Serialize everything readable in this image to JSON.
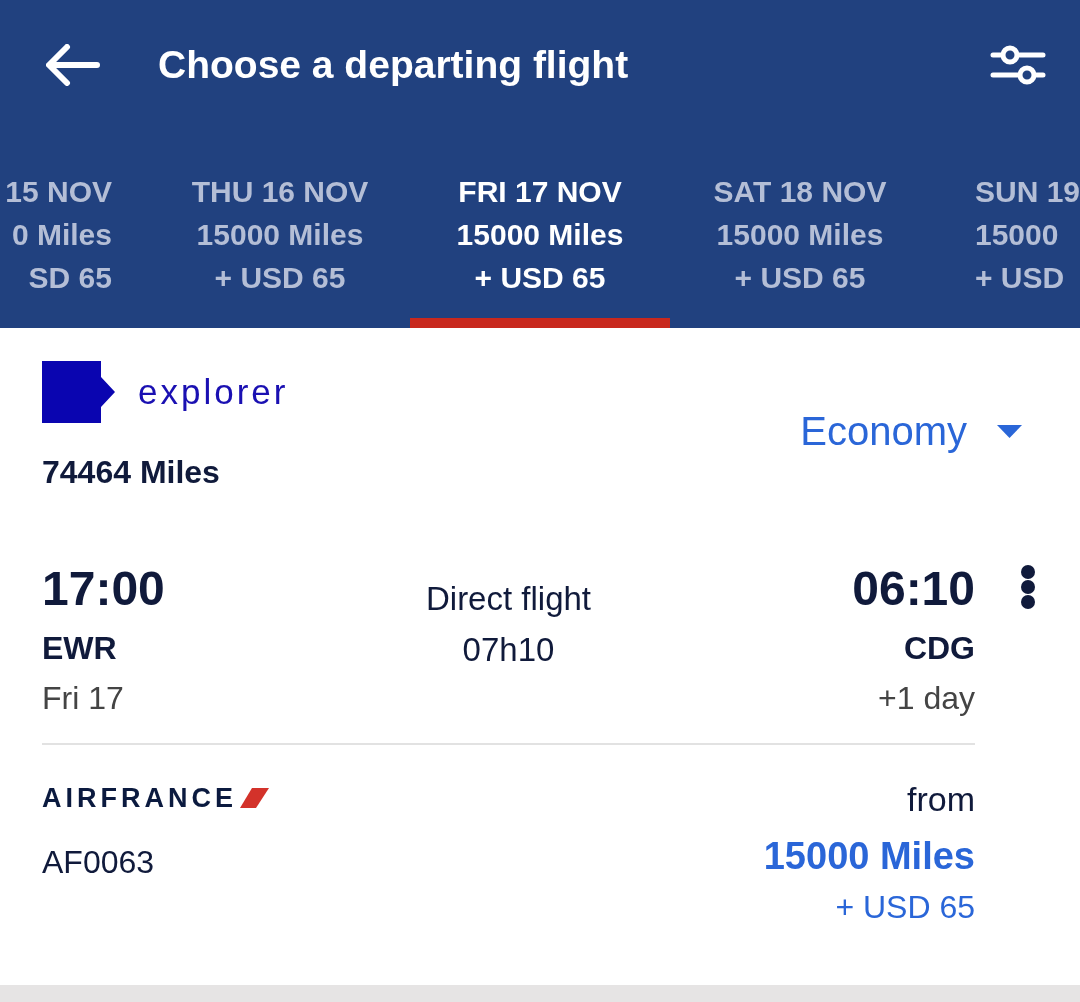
{
  "header": {
    "title": "Choose a departing flight"
  },
  "date_tabs": [
    {
      "date": "15 NOV",
      "price": "0 Miles",
      "fee": "SD 65",
      "selected": false
    },
    {
      "date": "THU 16 NOV",
      "price": "15000 Miles",
      "fee": "+ USD 65",
      "selected": false
    },
    {
      "date": "FRI 17 NOV",
      "price": "15000 Miles",
      "fee": "+ USD 65",
      "selected": true
    },
    {
      "date": "SAT 18 NOV",
      "price": "15000 Miles",
      "fee": "+ USD 65",
      "selected": false
    },
    {
      "date": "SUN 19",
      "price": "15000",
      "fee": "+ USD",
      "selected": false
    }
  ],
  "account": {
    "program": "explorer",
    "balance": "74464 Miles"
  },
  "cabin_selector": {
    "value": "Economy"
  },
  "flight": {
    "departure": {
      "time": "17:00",
      "airport": "EWR",
      "date": "Fri 17"
    },
    "stops": "Direct flight",
    "duration": "07h10",
    "arrival": {
      "time": "06:10",
      "airport": "CDG",
      "date": "+1 day"
    },
    "airline": "AIRFRANCE",
    "flight_number": "AF0063",
    "price_label": "from",
    "price": "15000 Miles",
    "fee": "+ USD 65"
  }
}
